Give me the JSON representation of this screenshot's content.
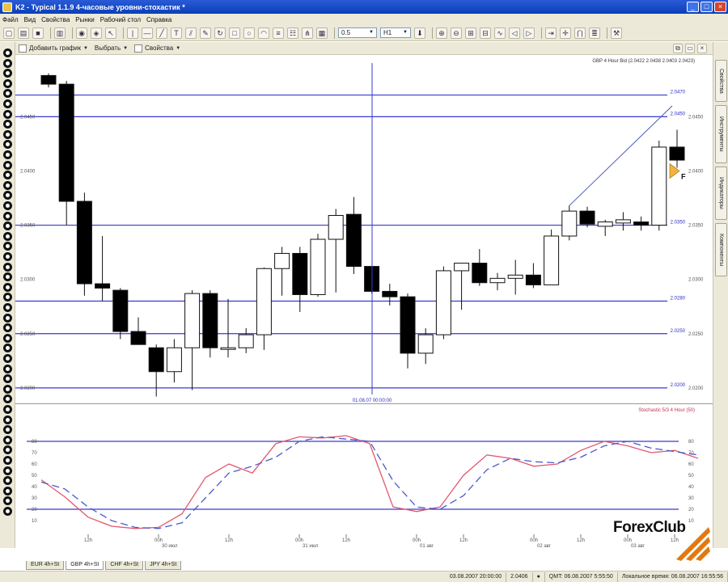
{
  "window": {
    "title": "K2 - Typical 1.1.9 4-часовые уровни-стохастик *",
    "min_label": "_",
    "max_label": "□",
    "close_label": "×"
  },
  "menu": [
    "Файл",
    "Вид",
    "Свойства",
    "Рынки",
    "Рабочий стол",
    "Справка"
  ],
  "toolbar": {
    "lot_value": "0.5",
    "timeframe_value": "H1"
  },
  "chart_toolbar": {
    "add_chart": "Добавить график",
    "select": "Выбрать",
    "properties": "Свойства"
  },
  "side_tabs": [
    "Свойства",
    "Инструменты",
    "Индикаторы",
    "Компоненты"
  ],
  "chart_data": [
    {
      "type": "candlestick",
      "title": "GBP 4 Hour Bid (2.0422 2.0438 2.0403 2.0423)",
      "ylim": [
        2.0185,
        2.0495
      ],
      "y_tick_labels": [
        {
          "value": 2.045,
          "label": "2.0450"
        },
        {
          "value": 2.04,
          "label": "2.0400"
        },
        {
          "value": 2.035,
          "label": "2.0350"
        },
        {
          "value": 2.03,
          "label": "2.0300"
        },
        {
          "value": 2.025,
          "label": "2.0250"
        },
        {
          "value": 2.02,
          "label": "2.0200"
        }
      ],
      "levels": [
        {
          "value": 2.047,
          "label": "2.0470"
        },
        {
          "value": 2.045,
          "label": "2.0450"
        },
        {
          "value": 2.035,
          "label": "2.0350"
        },
        {
          "value": 2.028,
          "label": "2.0280"
        },
        {
          "value": 2.025,
          "label": "2.0250"
        },
        {
          "value": 2.02,
          "label": "2.0200"
        }
      ],
      "cursor_label": "01.08.07 00:00:00",
      "marker_label": "F",
      "candles": [
        {
          "o": 2.0488,
          "h": 2.049,
          "l": 2.0477,
          "c": 2.048
        },
        {
          "o": 2.048,
          "h": 2.0483,
          "l": 2.035,
          "c": 2.0372
        },
        {
          "o": 2.0372,
          "h": 2.038,
          "l": 2.0285,
          "c": 2.0296
        },
        {
          "o": 2.0296,
          "h": 2.034,
          "l": 2.028,
          "c": 2.0292
        },
        {
          "o": 2.029,
          "h": 2.0292,
          "l": 2.0245,
          "c": 2.0252
        },
        {
          "o": 2.0252,
          "h": 2.0265,
          "l": 2.024,
          "c": 2.024
        },
        {
          "o": 2.0237,
          "h": 2.024,
          "l": 2.0192,
          "c": 2.0215
        },
        {
          "o": 2.0215,
          "h": 2.0245,
          "l": 2.0205,
          "c": 2.0237
        },
        {
          "o": 2.0237,
          "h": 2.029,
          "l": 2.0198,
          "c": 2.0287
        },
        {
          "o": 2.0287,
          "h": 2.029,
          "l": 2.0228,
          "c": 2.0237
        },
        {
          "o": 2.0237,
          "h": 2.0282,
          "l": 2.0228,
          "c": 2.0237
        },
        {
          "o": 2.0237,
          "h": 2.0255,
          "l": 2.0232,
          "c": 2.0249
        },
        {
          "o": 2.0249,
          "h": 2.0311,
          "l": 2.0235,
          "c": 2.031
        },
        {
          "o": 2.031,
          "h": 2.033,
          "l": 2.0285,
          "c": 2.0324
        },
        {
          "o": 2.0324,
          "h": 2.033,
          "l": 2.027,
          "c": 2.0286
        },
        {
          "o": 2.0286,
          "h": 2.0342,
          "l": 2.0284,
          "c": 2.0337
        },
        {
          "o": 2.0337,
          "h": 2.0365,
          "l": 2.0288,
          "c": 2.0359
        },
        {
          "o": 2.036,
          "h": 2.0376,
          "l": 2.0305,
          "c": 2.0312
        },
        {
          "o": 2.0312,
          "h": 2.0312,
          "l": 2.0287,
          "c": 2.0289
        },
        {
          "o": 2.0289,
          "h": 2.0296,
          "l": 2.0276,
          "c": 2.0284
        },
        {
          "o": 2.0284,
          "h": 2.0287,
          "l": 2.0218,
          "c": 2.0232
        },
        {
          "o": 2.0232,
          "h": 2.0255,
          "l": 2.0222,
          "c": 2.0249
        },
        {
          "o": 2.0249,
          "h": 2.0312,
          "l": 2.0245,
          "c": 2.0308
        },
        {
          "o": 2.0308,
          "h": 2.0315,
          "l": 2.0272,
          "c": 2.0315
        },
        {
          "o": 2.0315,
          "h": 2.0328,
          "l": 2.0294,
          "c": 2.0297
        },
        {
          "o": 2.0297,
          "h": 2.0306,
          "l": 2.029,
          "c": 2.0301
        },
        {
          "o": 2.0301,
          "h": 2.0318,
          "l": 2.0286,
          "c": 2.0304
        },
        {
          "o": 2.0304,
          "h": 2.0315,
          "l": 2.0292,
          "c": 2.0295
        },
        {
          "o": 2.0295,
          "h": 2.0346,
          "l": 2.0295,
          "c": 2.034
        },
        {
          "o": 2.034,
          "h": 2.0368,
          "l": 2.0336,
          "c": 2.0363
        },
        {
          "o": 2.0363,
          "h": 2.0367,
          "l": 2.0348,
          "c": 2.0351
        },
        {
          "o": 2.0349,
          "h": 2.0355,
          "l": 2.034,
          "c": 2.0353
        },
        {
          "o": 2.0352,
          "h": 2.0362,
          "l": 2.0345,
          "c": 2.0355
        },
        {
          "o": 2.0353,
          "h": 2.0358,
          "l": 2.0345,
          "c": 2.035
        },
        {
          "o": 2.035,
          "h": 2.0428,
          "l": 2.0345,
          "c": 2.0422
        },
        {
          "o": 2.0422,
          "h": 2.0438,
          "l": 2.0403,
          "c": 2.041
        }
      ]
    },
    {
      "type": "line",
      "title": "Stochastic 5/3 4 Hour (50)",
      "ylim": [
        0,
        100
      ],
      "levels": [
        80,
        20
      ],
      "y_tick_labels": [
        80,
        70,
        60,
        50,
        40,
        30,
        20,
        10
      ],
      "series": [
        {
          "name": "Stochastic 5/3 4 Hour (50)",
          "color": "#e0586e",
          "values": [
            46,
            31,
            13,
            5,
            3,
            4,
            16,
            48,
            60,
            52,
            78,
            84,
            83,
            85,
            78,
            22,
            18,
            22,
            50,
            68,
            65,
            58,
            60,
            72,
            80,
            76,
            70,
            72,
            65
          ]
        },
        {
          "name": "Stochastic 5/3 4 Hour (50)",
          "color": "#4a5ac8",
          "dash": "9,5",
          "values": [
            44,
            38,
            22,
            10,
            4,
            3,
            8,
            30,
            52,
            58,
            66,
            80,
            84,
            82,
            80,
            45,
            22,
            20,
            32,
            55,
            65,
            62,
            61,
            66,
            76,
            80,
            74,
            71,
            68
          ]
        }
      ],
      "x_tick_labels": [
        {
          "idx": 2,
          "label": "12h"
        },
        {
          "idx": 5,
          "label": "00h"
        },
        {
          "idx": 8,
          "label": "12h"
        },
        {
          "idx": 11,
          "label": "00h"
        },
        {
          "idx": 13,
          "label": "12h"
        },
        {
          "idx": 16,
          "label": "00h"
        },
        {
          "idx": 18,
          "label": "12h"
        },
        {
          "idx": 21,
          "label": "00h"
        },
        {
          "idx": 23,
          "label": "12h"
        },
        {
          "idx": 25,
          "label": "00h"
        },
        {
          "idx": 27,
          "label": "12h"
        }
      ],
      "date_labels": [
        {
          "idx": 5,
          "label": "30 июл"
        },
        {
          "idx": 11,
          "label": "31 июл"
        },
        {
          "idx": 16,
          "label": "01 авг"
        },
        {
          "idx": 21,
          "label": "02 авг"
        },
        {
          "idx": 25,
          "label": "03 авг"
        }
      ]
    }
  ],
  "symbol_tabs": [
    "EUR 4h+St",
    "GBP 4h+St",
    "CHF 4h+St",
    "JPY 4h+St"
  ],
  "active_symbol_tab": 1,
  "status": {
    "time1": "03.08.2007 20:00:00",
    "price": "2.0406",
    "server_label": "QMT:",
    "server_time": "06.08.2007 5:55:50",
    "local_label": "Локальное время:",
    "local_time": "06.08.2007 16:55:56"
  },
  "logo": {
    "text": "ForexClub"
  }
}
